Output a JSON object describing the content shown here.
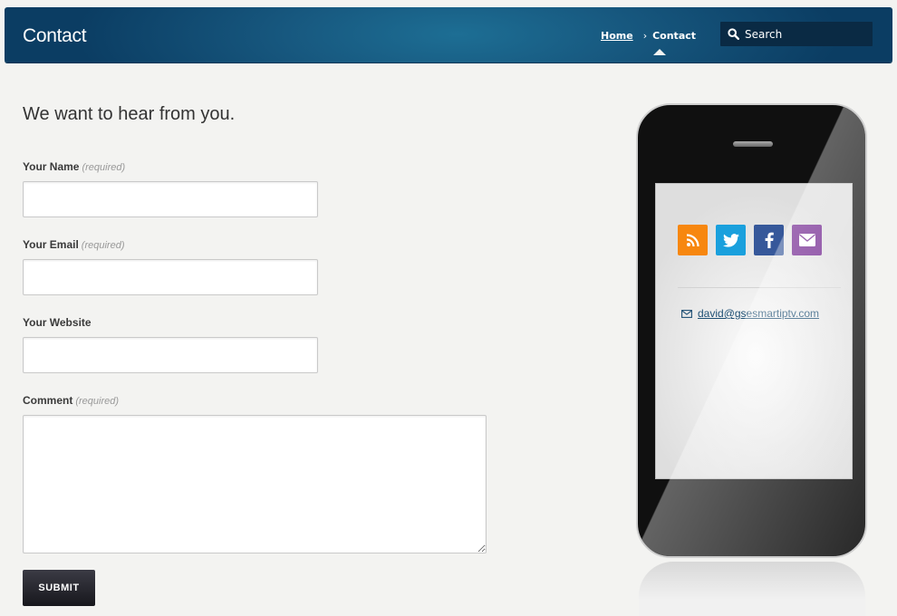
{
  "header": {
    "title": "Contact",
    "breadcrumb": {
      "home": "Home",
      "separator": "›",
      "current": "Contact"
    },
    "search_placeholder": "Search"
  },
  "form": {
    "headline": "We want to hear from you.",
    "fields": [
      {
        "label": "Your Name",
        "required_note": "(required)",
        "value": ""
      },
      {
        "label": "Your Email",
        "required_note": "(required)",
        "value": ""
      },
      {
        "label": "Your Website",
        "required_note": "",
        "value": ""
      }
    ],
    "comment": {
      "label": "Comment",
      "required_note": "(required)",
      "value": ""
    },
    "submit_label": "SUBMIT"
  },
  "phone": {
    "socials": [
      {
        "name": "rss",
        "color": "#f7870f"
      },
      {
        "name": "twitter",
        "color": "#1aa0dd"
      },
      {
        "name": "facebook",
        "color": "#36589a"
      },
      {
        "name": "email",
        "color": "#6d1f8c"
      }
    ],
    "email": "david@gsesmartiptv.com"
  },
  "colors": {
    "header_dark": "#0b3d63",
    "header_light": "#1d6e94",
    "link": "#1e4f74"
  }
}
